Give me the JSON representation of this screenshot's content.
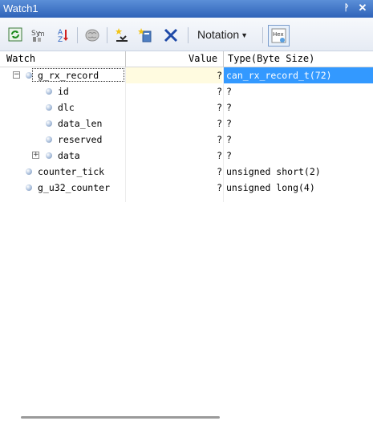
{
  "window": {
    "title": "Watch1",
    "pin_glyph": "⬆",
    "close_glyph": "✕"
  },
  "toolbar": {
    "notation_label": "Notation",
    "hex_label": "Hex",
    "icons": [
      "refresh-icon",
      "symbol-icon",
      "sort-icon",
      "brain-icon",
      "add-watch-icon",
      "add-item-icon",
      "delete-icon"
    ]
  },
  "columns": {
    "watch": "Watch",
    "value": "Value",
    "type": "Type(Byte Size)"
  },
  "rows": [
    {
      "name": "g_rx_record",
      "value": "?",
      "type": "can_rx_record_t(72)",
      "expander": "−"
    },
    {
      "name": "id",
      "value": "?",
      "type": "?"
    },
    {
      "name": "dlc",
      "value": "?",
      "type": "?"
    },
    {
      "name": "data_len",
      "value": "?",
      "type": "?"
    },
    {
      "name": "reserved",
      "value": "?",
      "type": "?"
    },
    {
      "name": "data",
      "value": "?",
      "type": "?",
      "expander": "+"
    },
    {
      "name": "counter_tick",
      "value": "?",
      "type": "unsigned short(2)"
    },
    {
      "name": "g_u32_counter",
      "value": "?",
      "type": "unsigned long(4)"
    }
  ],
  "colors": {
    "title_bar": "#2f63b9",
    "selection": "#3399ff",
    "value_highlight": "#fffbe0"
  }
}
